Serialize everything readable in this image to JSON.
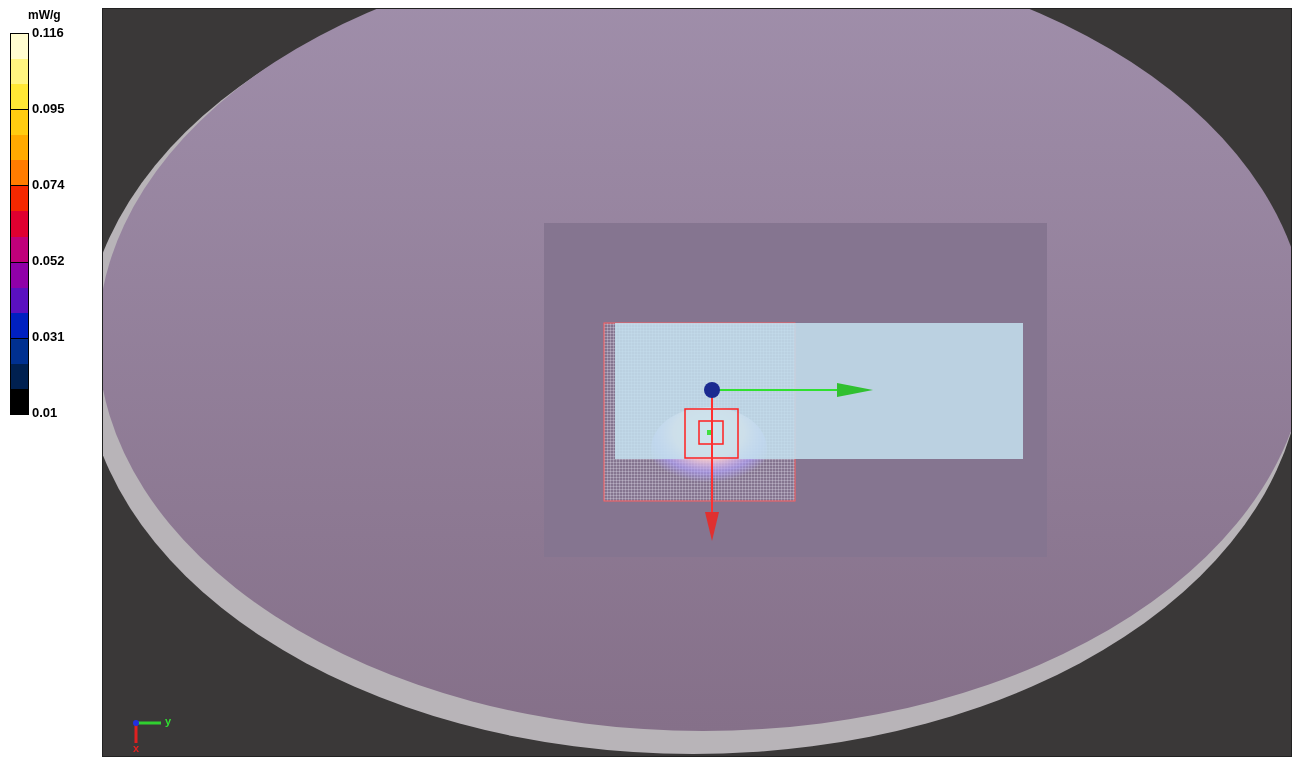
{
  "legend": {
    "unit": "mW/g",
    "ticks": [
      "0.116",
      "0.095",
      "0.074",
      "0.052",
      "0.031",
      "0.01"
    ],
    "segments": [
      {
        "color": "#fffcd0"
      },
      {
        "color": "#fff580"
      },
      {
        "color": "#ffe835"
      },
      {
        "color": "#ffcc10"
      },
      {
        "color": "#ffaa00"
      },
      {
        "color": "#ff7c00"
      },
      {
        "color": "#f52800"
      },
      {
        "color": "#e00030"
      },
      {
        "color": "#c0007a"
      },
      {
        "color": "#9000a8"
      },
      {
        "color": "#5a10c0"
      },
      {
        "color": "#0020c0"
      },
      {
        "color": "#003090"
      },
      {
        "color": "#002050"
      },
      {
        "color": "#000000"
      }
    ]
  },
  "axes_triad": {
    "y_label": "y",
    "x_label": "x"
  }
}
